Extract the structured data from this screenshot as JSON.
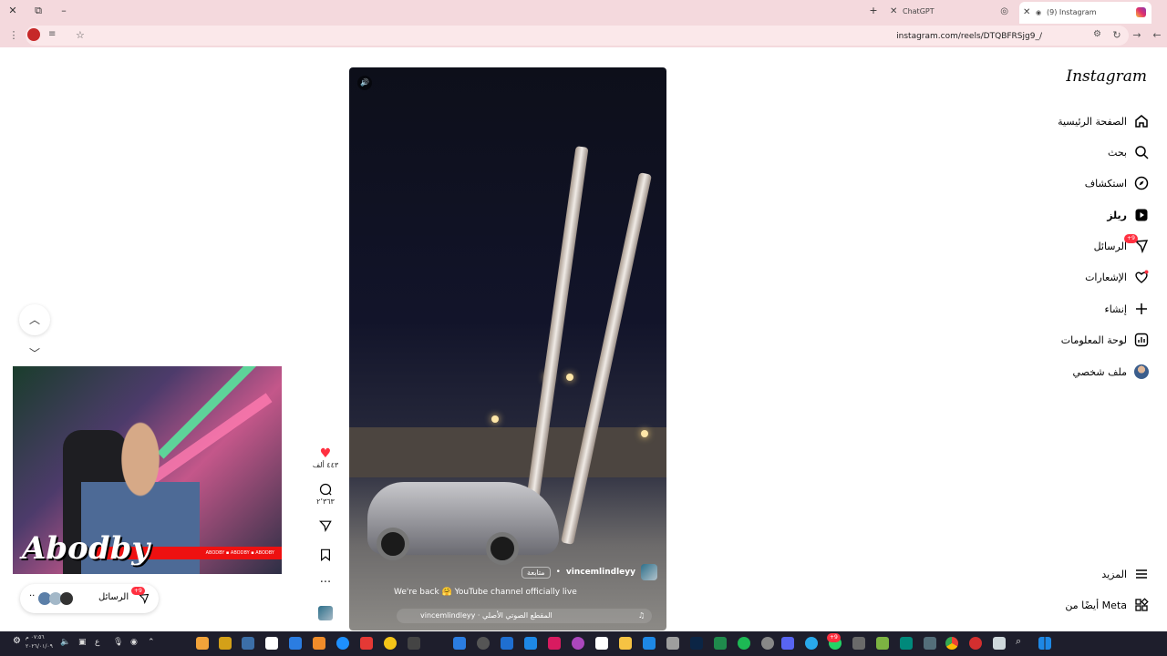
{
  "browser": {
    "tabs": [
      {
        "title": "(9) Instagram",
        "active": true
      },
      {
        "title": "ChatGPT",
        "active": false
      }
    ],
    "url": "instagram.com/reels/DTQBFRSjg9_/",
    "colors": {
      "frame": "#f4d9dd",
      "omnibox": "#fbe8ea"
    }
  },
  "instagram": {
    "logo": "Instagram",
    "nav": [
      {
        "label": "الصفحة الرئيسية",
        "icon": "home-icon"
      },
      {
        "label": "بحث",
        "icon": "search-icon"
      },
      {
        "label": "استكشاف",
        "icon": "explore-icon"
      },
      {
        "label": "ريلز",
        "icon": "reels-icon"
      },
      {
        "label": "الرسائل",
        "icon": "messages-icon",
        "badge": "+9"
      },
      {
        "label": "الإشعارات",
        "icon": "heart-icon"
      },
      {
        "label": "إنشاء",
        "icon": "plus-icon"
      },
      {
        "label": "لوحة المعلومات",
        "icon": "dashboard-icon"
      },
      {
        "label": "ملف شخصي",
        "icon": "profile-avatar"
      }
    ],
    "nav_bottom": [
      {
        "label": "المزيد",
        "icon": "menu-icon"
      },
      {
        "label": "أيضًا من Meta",
        "icon": "meta-apps-icon"
      }
    ],
    "reel": {
      "username": "vincemlindleyy",
      "follow_label": "متابعة",
      "caption": "We're back 🤗 YouTube channel officially live",
      "audio": "vincemlindleyy · المقطع الصوتي الأصلي",
      "likes": "٤٤٣ ألف",
      "comments": "٢٬٣٦٣"
    },
    "messages_pill": {
      "label": "الرسائل",
      "badge": "+9"
    }
  },
  "webcam": {
    "overlay_name": "Abodby",
    "ticker": "ABODBY ▪ ABODBY ▪ ABODBY"
  },
  "taskbar": {
    "clock": "٠٧:٥٦ م",
    "date": "٢٠٢٦/٠١/٠٩",
    "lang": "ع",
    "tray_badge": "+9"
  },
  "colors": {
    "like": "#ff3040",
    "taskbar": "#1e1e2c"
  }
}
